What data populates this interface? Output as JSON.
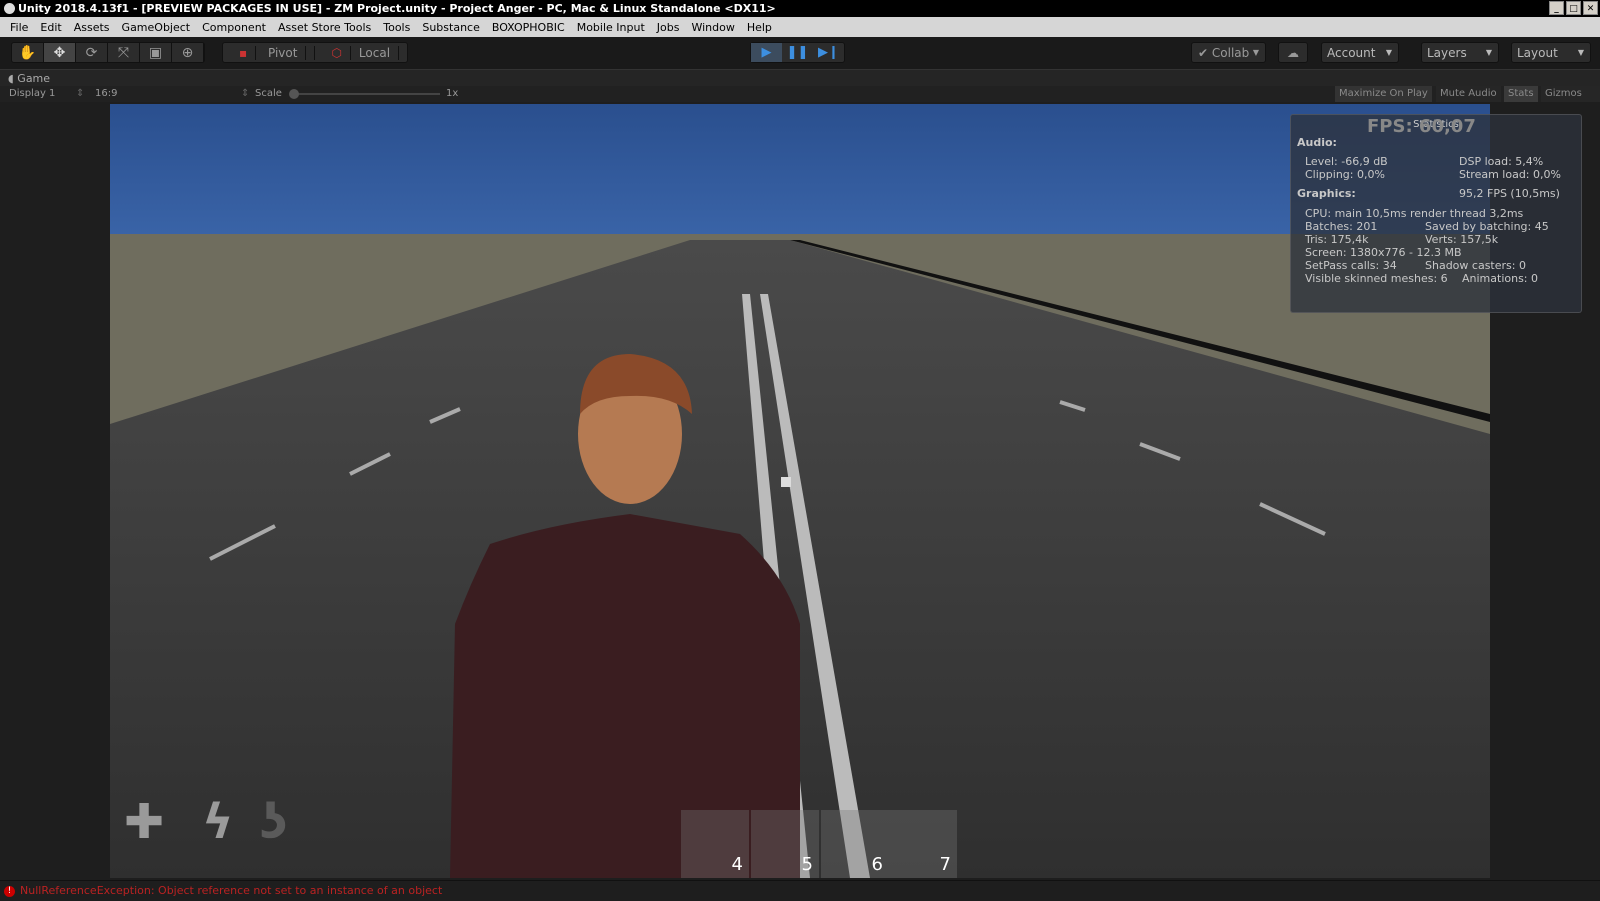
{
  "window": {
    "title": "Unity 2018.4.13f1 - [PREVIEW PACKAGES IN USE] - ZM Project.unity - Project Anger - PC, Mac & Linux Standalone <DX11>"
  },
  "menu": [
    "File",
    "Edit",
    "Assets",
    "GameObject",
    "Component",
    "Asset Store Tools",
    "Tools",
    "Substance",
    "BOXOPHOBIC",
    "Mobile Input",
    "Jobs",
    "Window",
    "Help"
  ],
  "toolbar": {
    "pivot": "Pivot",
    "local": "Local",
    "collab": "Collab",
    "account": "Account",
    "layers": "Layers",
    "layout": "Layout",
    "active_tool": "move",
    "playing": true
  },
  "game_panel": {
    "tab": "Game",
    "display": "Display 1",
    "aspect": "16:9",
    "scale_label": "Scale",
    "scale_value": "1x",
    "maximize": "Maximize On Play",
    "mute": "Mute Audio",
    "stats": "Stats",
    "gizmos": "Gizmos"
  },
  "stats": {
    "title": "Statistics",
    "fps_overlay": "FPS: 60,07",
    "audio_header": "Audio:",
    "level": "Level: -66,9 dB",
    "dsp": "DSP load: 5,4%",
    "clipping": "Clipping: 0,0%",
    "stream": "Stream load: 0,0%",
    "graphics_header": "Graphics:",
    "gfps": "95,2 FPS (10,5ms)",
    "cpu": "CPU: main 10,5ms  render thread 3,2ms",
    "batches": "Batches: 201",
    "saved": "Saved by batching: 45",
    "tris": "Tris: 175,4k",
    "verts": "Verts: 157,5k",
    "screen": "Screen: 1380x776 - 12.3 MB",
    "setpass": "SetPass calls: 34",
    "shadow": "Shadow casters: 0",
    "skinned": "Visible skinned meshes: 6",
    "anim": "Animations: 0"
  },
  "hud": {
    "icons": [
      "health-plus",
      "energy-bolt",
      "hunger-stomach"
    ],
    "slots": [
      "4",
      "5",
      "6",
      "7"
    ]
  },
  "console": {
    "error": "NullReferenceException: Object reference not set to an instance of an object"
  },
  "colors": {
    "accent": "#3d8fe0",
    "sky": "#2f5796",
    "error": "#b22222"
  }
}
